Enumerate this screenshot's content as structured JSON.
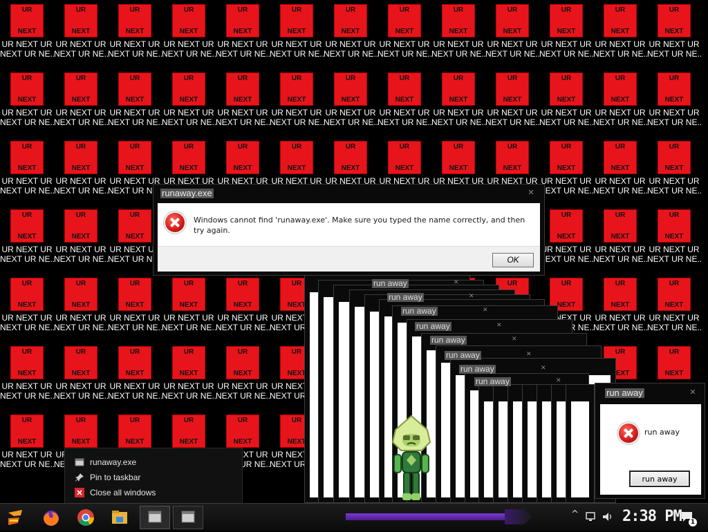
{
  "desktop": {
    "icon_caption_top": "UR",
    "icon_caption_bottom": "NEXT",
    "icon_label_line1": "UR NEXT UR",
    "icon_label_line2": "NEXT UR NE...",
    "columns": 13,
    "rows": 7
  },
  "error_dialog": {
    "title": "runaway.exe",
    "message": "Windows cannot find 'runaway.exe'. Make sure you typed the name correctly, and then try again.",
    "ok_label": "OK",
    "close_glyph": "✕"
  },
  "stacked_windows": {
    "title": "run away",
    "close_glyph": "✕"
  },
  "runaway_dialog": {
    "title": "run away",
    "message": "run away",
    "button_label": "run away",
    "close_glyph": "✕"
  },
  "jump_list": {
    "items": [
      {
        "label": "runaway.exe",
        "icon": "app-icon"
      },
      {
        "label": "Pin to taskbar",
        "icon": "pin-icon"
      },
      {
        "label": "Close all windows",
        "icon": "close-icon"
      }
    ]
  },
  "taskbar": {
    "pinned": [
      "start-button",
      "firefox-icon",
      "chrome-icon",
      "file-explorer-icon",
      "runaway-app-icon",
      "runaway-app-icon-2"
    ],
    "tray_chevron": "^",
    "clock": "2:38 PM",
    "notification_count": "1"
  },
  "colors": {
    "desktop_bg": "#000000",
    "icon_red": "#e8141c",
    "accent_purple": "#6a2fb8"
  }
}
